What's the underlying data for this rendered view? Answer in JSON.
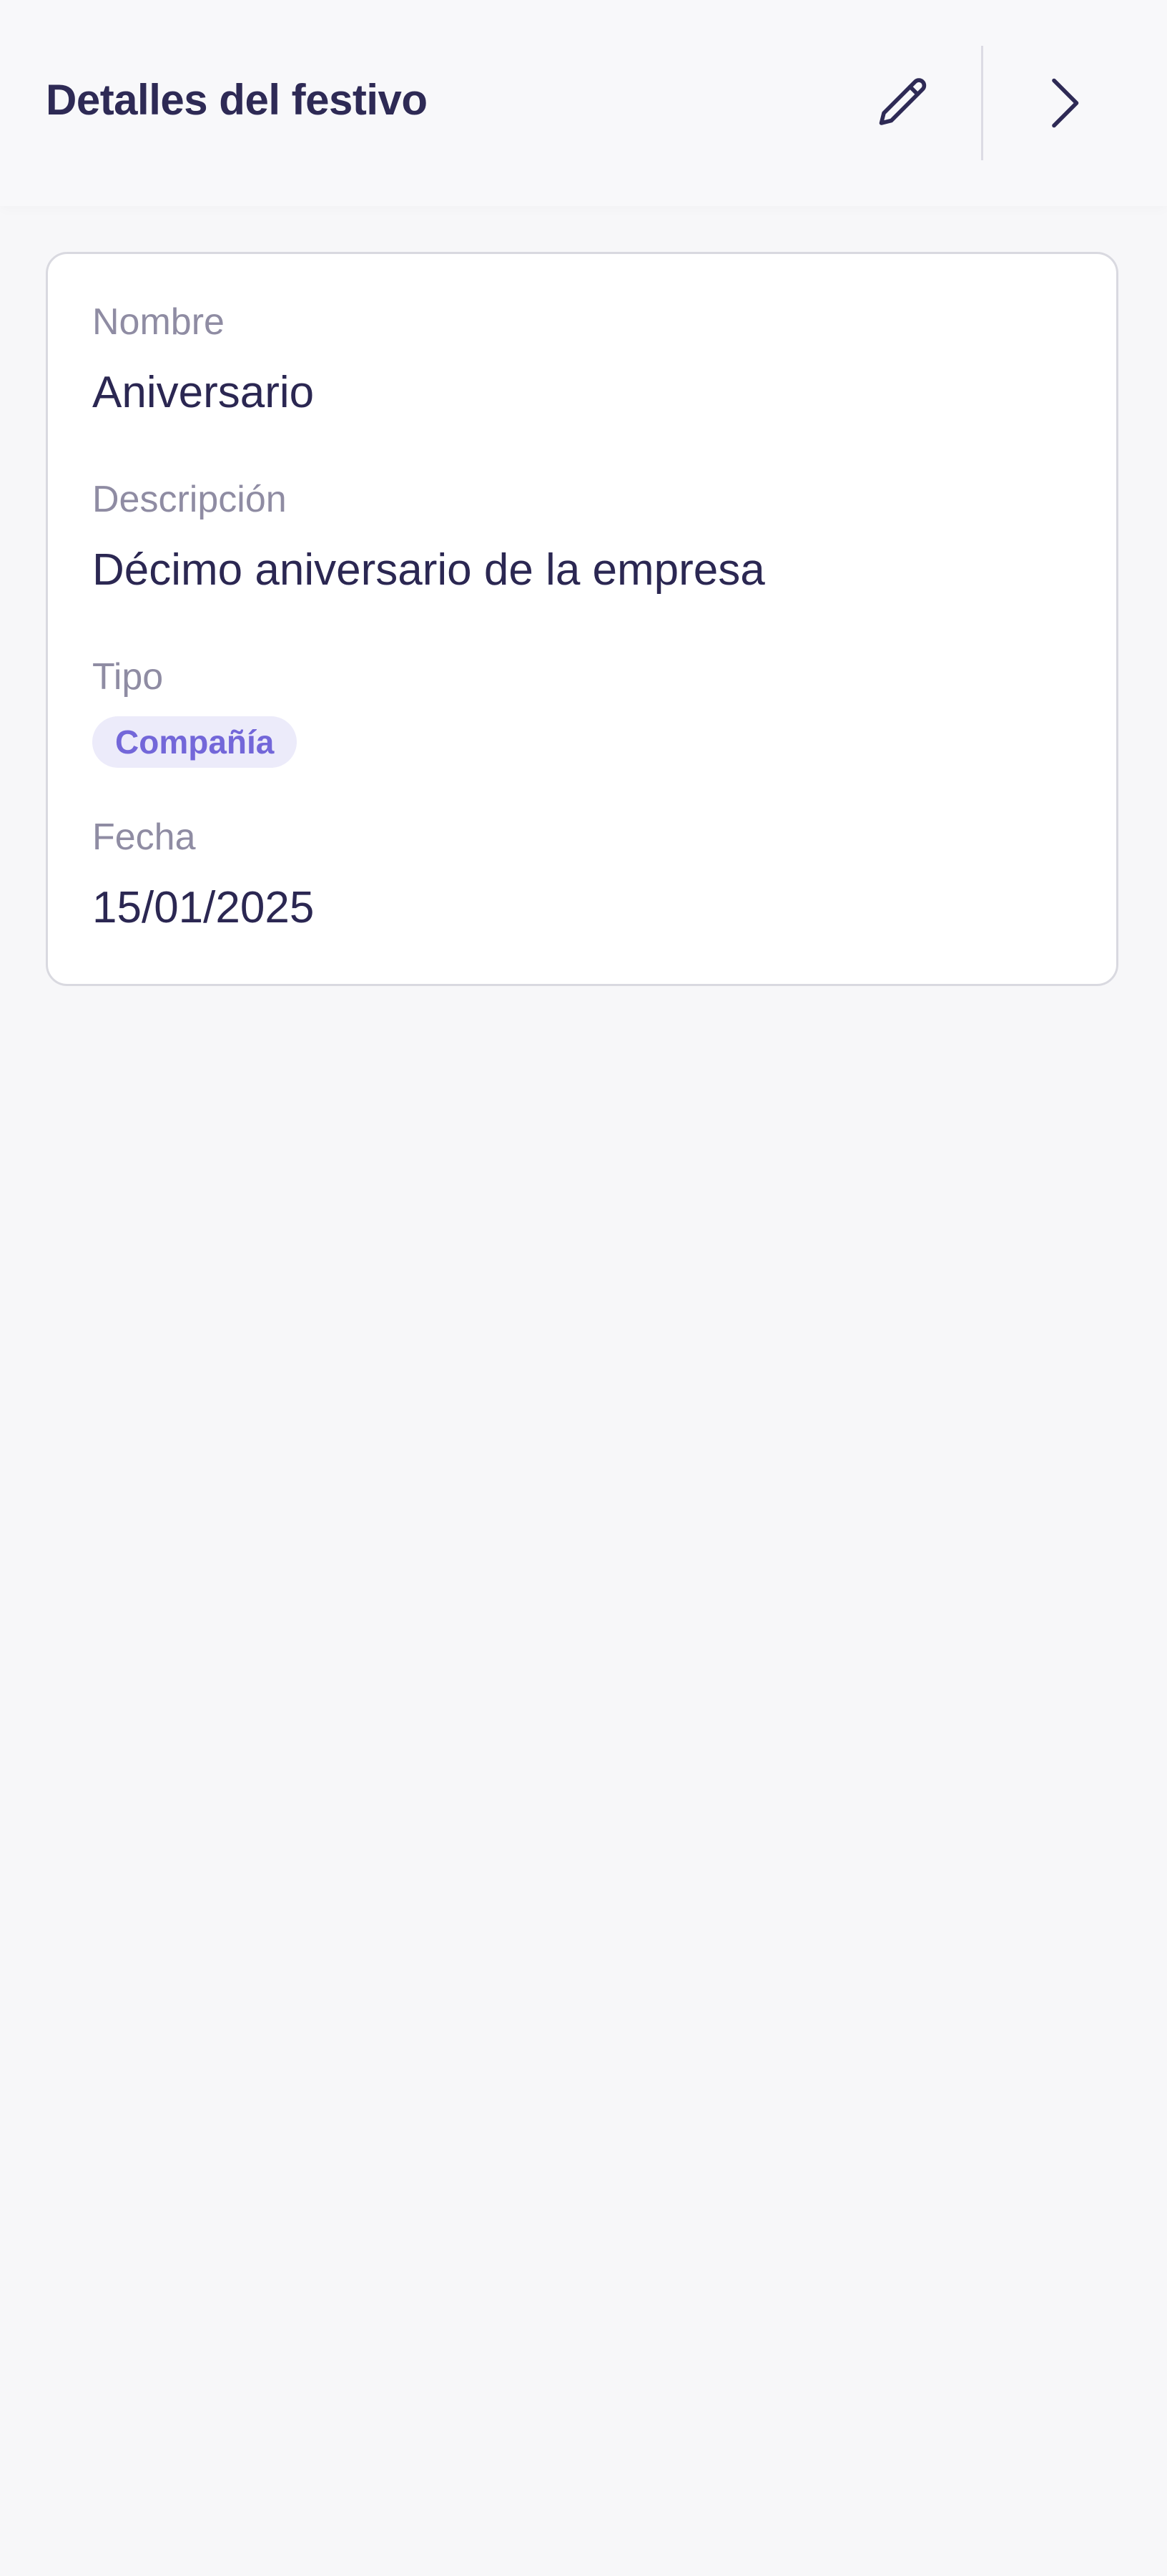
{
  "header": {
    "title": "Detalles del festivo",
    "edit_icon": "pencil-icon",
    "next_icon": "chevron-right-icon"
  },
  "details": {
    "name_label": "Nombre",
    "name_value": "Aniversario",
    "description_label": "Descripción",
    "description_value": "Décimo aniversario de la empresa",
    "type_label": "Tipo",
    "type_badge": "Compañía",
    "date_label": "Fecha",
    "date_value": "15/01/2025"
  },
  "colors": {
    "background": "#f7f7f9",
    "title": "#2e2a55",
    "label": "#8f8ca3",
    "value": "#2b2752",
    "badge_bg": "#ecebfa",
    "badge_text": "#7367d9",
    "card_border": "#d9d9e0"
  }
}
